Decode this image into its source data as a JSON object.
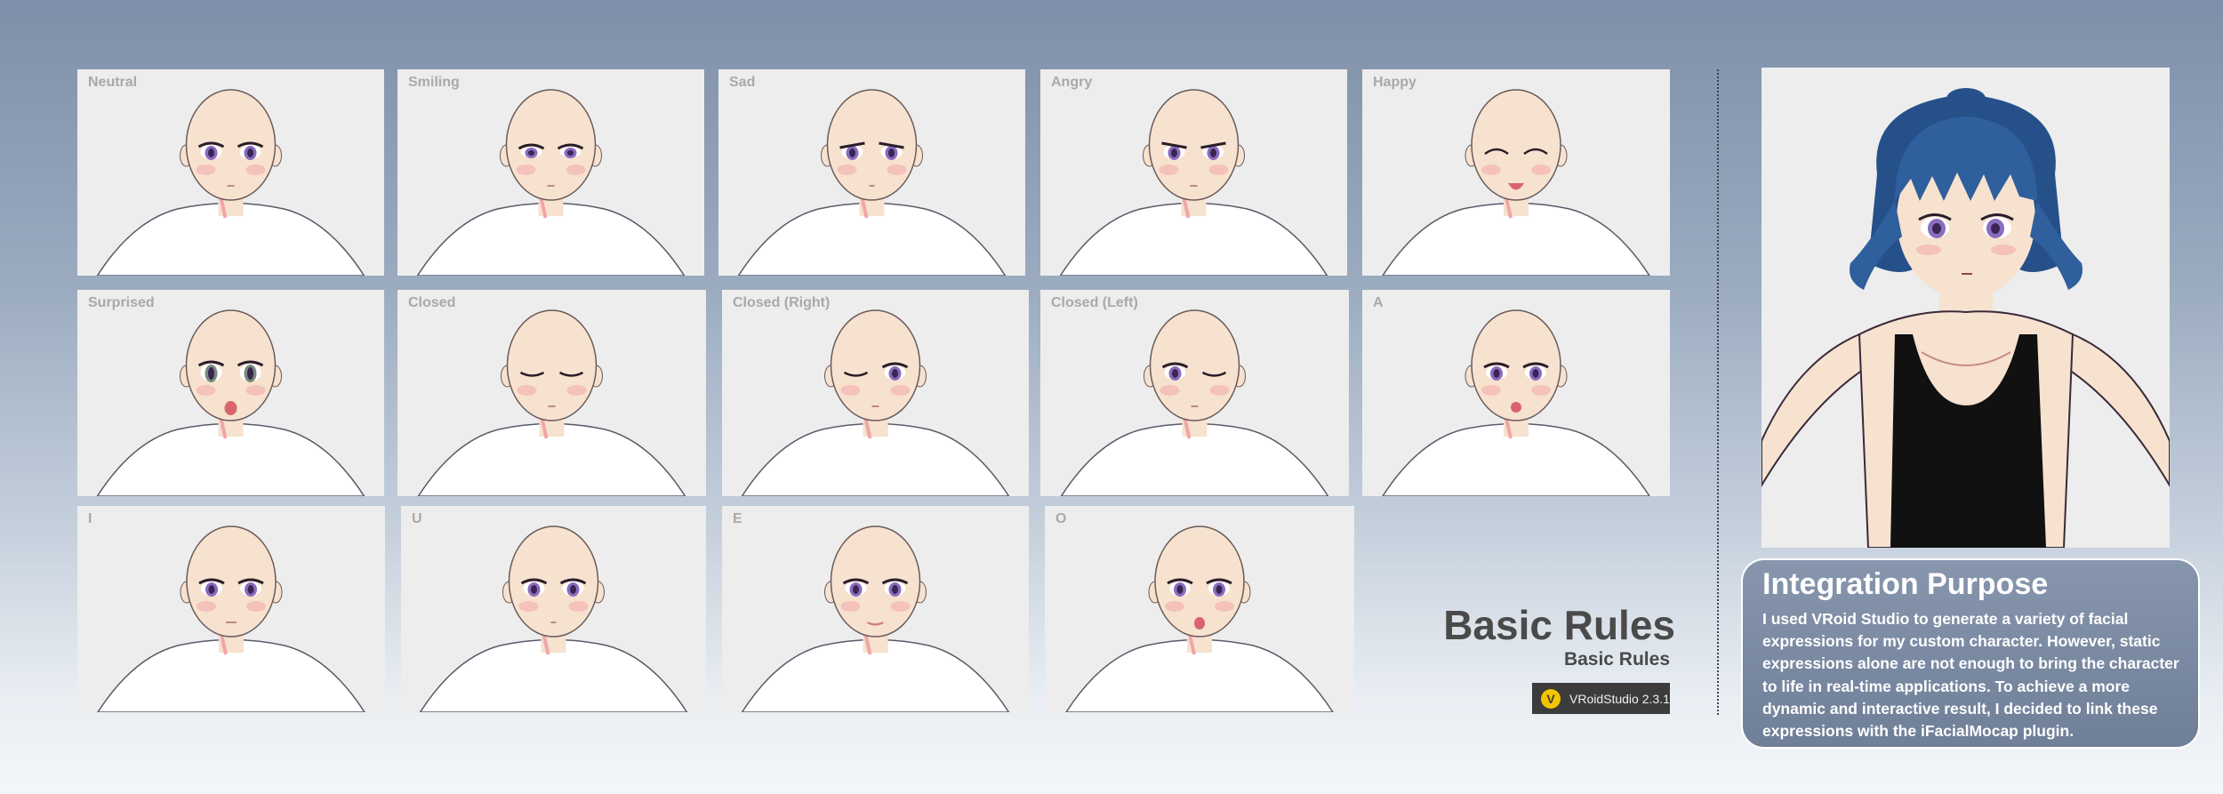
{
  "expressions": [
    {
      "label": "Neutral",
      "eyes": "open",
      "mouth": "closed",
      "brows": "normal"
    },
    {
      "label": "Smiling",
      "eyes": "smile-open",
      "mouth": "closed",
      "brows": "normal"
    },
    {
      "label": "Sad",
      "eyes": "sad",
      "mouth": "small",
      "brows": "sad"
    },
    {
      "label": "Angry",
      "eyes": "angry",
      "mouth": "closed",
      "brows": "angry"
    },
    {
      "label": "Happy",
      "eyes": "closed-happy",
      "mouth": "open-wide",
      "brows": "normal"
    },
    {
      "label": "Surprised",
      "eyes": "wide",
      "mouth": "open-round",
      "brows": "raised"
    },
    {
      "label": "Closed",
      "eyes": "closed",
      "mouth": "closed",
      "brows": "normal"
    },
    {
      "label": "Closed (Right)",
      "eyes": "wink-left",
      "mouth": "closed",
      "brows": "normal"
    },
    {
      "label": "Closed (Left)",
      "eyes": "wink-right",
      "mouth": "closed",
      "brows": "normal"
    },
    {
      "label": "A",
      "eyes": "open",
      "mouth": "open-a",
      "brows": "normal"
    },
    {
      "label": "I",
      "eyes": "open",
      "mouth": "line",
      "brows": "normal"
    },
    {
      "label": "U",
      "eyes": "open",
      "mouth": "small",
      "brows": "normal"
    },
    {
      "label": "E",
      "eyes": "open",
      "mouth": "wide",
      "brows": "normal"
    },
    {
      "label": "O",
      "eyes": "open",
      "mouth": "open-o",
      "brows": "normal"
    }
  ],
  "title": {
    "main": "Basic Rules",
    "sub": "Basic Rules"
  },
  "badge": {
    "logo_letter": "V",
    "text": "VRoidStudio 2.3.1"
  },
  "info": {
    "title": "Integration Purpose",
    "body": "I used VRoid Studio to generate a variety of facial expressions for my custom character. However, static expressions alone are not enough to bring the character to life in real-time applications. To achieve a more dynamic and interactive result, I decided to link these expressions with the iFacialMocap plugin."
  },
  "colors": {
    "skin": "#f6e2cf",
    "eye": "#8a6cc0",
    "hair": "#2f5f9c",
    "shirt": "#ffffff",
    "tank_top": "#111111",
    "badge_logo": "#f2c500"
  }
}
